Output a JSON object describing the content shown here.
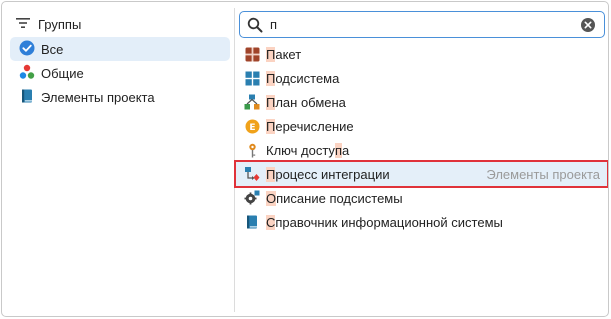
{
  "left_panel": {
    "header": {
      "label": "Группы",
      "icon": "filter-icon"
    },
    "items": [
      {
        "label": "Все",
        "icon": "checkmark-circle-icon",
        "selected": true
      },
      {
        "label": "Общие",
        "icon": "common-dots-icon",
        "selected": false
      },
      {
        "label": "Элементы проекта",
        "icon": "book-icon",
        "selected": false
      }
    ]
  },
  "search": {
    "value": "п",
    "placeholder": ""
  },
  "results": [
    {
      "pre": "",
      "hl": "П",
      "post": "акет",
      "icon": "package-icon",
      "group": ""
    },
    {
      "pre": "",
      "hl": "П",
      "post": "одсистема",
      "icon": "subsystem-icon",
      "group": ""
    },
    {
      "pre": "",
      "hl": "П",
      "post": "лан обмена",
      "icon": "exchange-plan-icon",
      "group": ""
    },
    {
      "pre": "",
      "hl": "П",
      "post": "еречисление",
      "icon": "enumeration-icon",
      "group": ""
    },
    {
      "pre": "Ключ досту",
      "hl": "п",
      "post": "а",
      "icon": "key-icon",
      "group": ""
    },
    {
      "pre": "",
      "hl": "П",
      "post": "роцесс интеграции",
      "icon": "integration-process-icon",
      "group": "Элементы проекта",
      "selected": true
    },
    {
      "pre": "",
      "hl": "О",
      "post": "писание подсистемы",
      "icon": "subsystem-description-icon",
      "group": ""
    },
    {
      "pre": "",
      "hl": "С",
      "post": "правочник информационной системы",
      "icon": "catalog-book-icon",
      "group": ""
    }
  ],
  "colors": {
    "accent": "#4a90d9",
    "selection": "#e3eef9",
    "highlight": "#fbd3c2",
    "annotation_border": "#e0323a"
  }
}
